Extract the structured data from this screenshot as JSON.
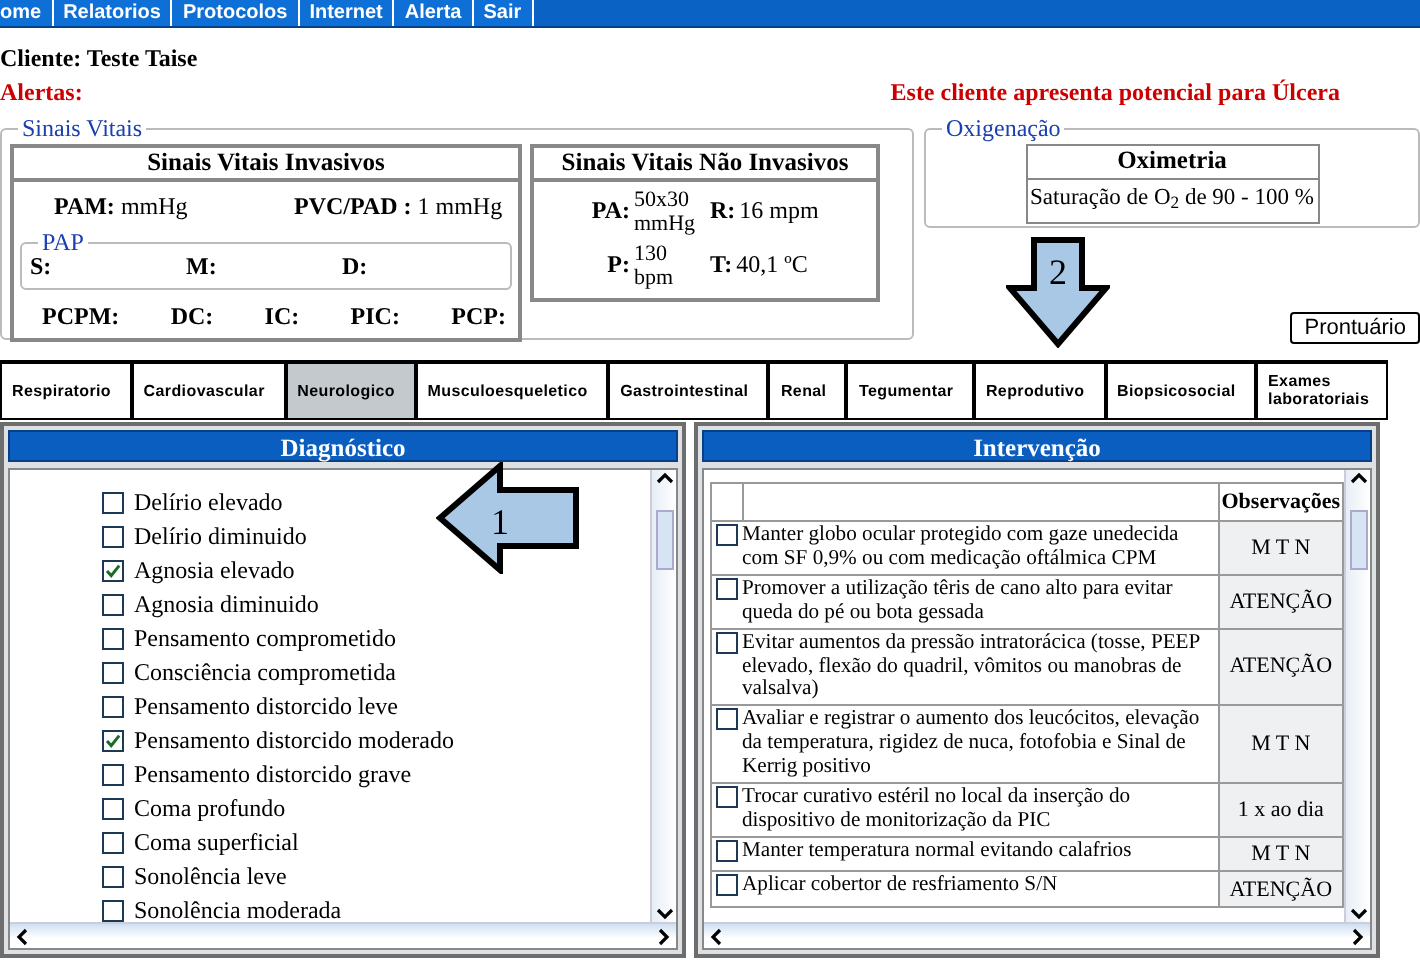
{
  "menu": [
    {
      "label": "ome"
    },
    {
      "label": "Relatorios"
    },
    {
      "label": "Protocolos"
    },
    {
      "label": "Internet"
    },
    {
      "label": "Alerta"
    },
    {
      "label": "Sair"
    }
  ],
  "client": "Cliente: Teste Taise",
  "alerts_label": "Alertas:",
  "alert_message": "Este cliente apresenta potencial para Úlcera",
  "vital_signs": {
    "legend": "Sinais Vitais",
    "invasive": {
      "title": "Sinais Vitais Invasivos",
      "pam_label": "PAM:",
      "pam_value": "mmHg",
      "pvc_label": "PVC/PAD :",
      "pvc_value": "1 mmHg",
      "pap": {
        "legend": "PAP",
        "fields": [
          "S:",
          "M:",
          "D:"
        ]
      },
      "other_fields": [
        "PCPM:",
        "DC:",
        "IC:",
        "PIC:",
        "PCP:"
      ]
    },
    "non_invasive": {
      "title": "Sinais Vitais Não Invasivos",
      "fields": [
        {
          "label": "PA:",
          "value": "50x30 mmHg"
        },
        {
          "label": "R:",
          "value": "16 mpm"
        },
        {
          "label": "P:",
          "value": "130 bpm"
        },
        {
          "label": "T:",
          "value": "40,1 ºC"
        }
      ]
    }
  },
  "oxygenation": {
    "legend": "Oxigenação",
    "title": "Oximetria",
    "value": "Saturação de O$_{2}$ de 90 - 100 %"
  },
  "annotations": [
    {
      "label": "2",
      "kind": "down"
    },
    {
      "label": "1",
      "kind": "left"
    }
  ],
  "record_button": "Prontuário",
  "tabs": [
    {
      "label": "Respiratorio",
      "selected": false
    },
    {
      "label": "Cardiovascular",
      "selected": false
    },
    {
      "label": "Neurologico",
      "selected": true
    },
    {
      "label": "Musculoesqueletico",
      "selected": false
    },
    {
      "label": "Gastrointestinal",
      "selected": false
    },
    {
      "label": "Renal",
      "selected": false
    },
    {
      "label": "Tegumentar",
      "selected": false
    },
    {
      "label": "Reprodutivo",
      "selected": false
    },
    {
      "label": "Biopsicosocial",
      "selected": false
    },
    {
      "label": "Exames laboratoriais",
      "selected": false
    }
  ],
  "diagnosis": {
    "title": "Diagnóstico",
    "items": [
      {
        "label": "Delírio elevado",
        "checked": false
      },
      {
        "label": "Delírio diminuido",
        "checked": false
      },
      {
        "label": "Agnosia elevado",
        "checked": true
      },
      {
        "label": "Agnosia diminuido",
        "checked": false
      },
      {
        "label": "Pensamento comprometido",
        "checked": false
      },
      {
        "label": "Consciência comprometida",
        "checked": false
      },
      {
        "label": "Pensamento distorcido leve",
        "checked": false
      },
      {
        "label": "Pensamento distorcido moderado",
        "checked": true
      },
      {
        "label": "Pensamento distorcido grave",
        "checked": false
      },
      {
        "label": "Coma profundo",
        "checked": false
      },
      {
        "label": "Coma superficial",
        "checked": false
      },
      {
        "label": "Sonolência leve",
        "checked": false
      },
      {
        "label": "Sonolência moderada",
        "checked": false
      }
    ]
  },
  "intervention": {
    "title": "Intervenção",
    "observations_header": "Observações",
    "rows": [
      {
        "text": "Manter globo ocular protegido com gaze unedecida com SF 0,9% ou com medicação oftálmica CPM",
        "observation": "M T N",
        "checked": false
      },
      {
        "text": "Promover a utilização têris de cano alto para evitar queda do pé ou bota gessada",
        "observation": "ATENÇÃO",
        "checked": false
      },
      {
        "text": "Evitar aumentos da pressão intratorácica (tosse, PEEP elevado, flexão do quadril, vômitos ou manobras de valsalva)",
        "observation": "ATENÇÃO",
        "checked": false
      },
      {
        "text": "Avaliar e registrar o aumento dos leucócitos, elevação da temperatura, rigidez de nuca, fotofobia e Sinal de Kerrig positivo",
        "observation": "M T N",
        "checked": false
      },
      {
        "text": "Trocar curativo estéril no local da inserção do dispositivo de monitorização da PIC",
        "observation": "1 x ao dia",
        "checked": false
      },
      {
        "text": "Manter temperatura normal evitando calafrios",
        "observation": "M T N",
        "checked": false
      },
      {
        "text": "Aplicar cobertor de resfriamento S/N",
        "observation": "ATENÇÃO",
        "checked": false
      }
    ]
  }
}
